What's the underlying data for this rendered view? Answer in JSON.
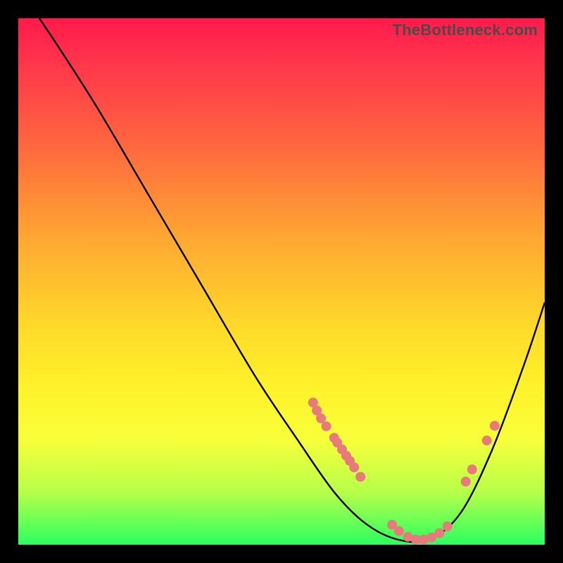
{
  "watermark": "TheBottleneck.com",
  "chart_data": {
    "type": "line",
    "title": "",
    "xlabel": "",
    "ylabel": "",
    "xlim": [
      0,
      100
    ],
    "ylim": [
      0,
      100
    ],
    "curve": [
      {
        "x": 4,
        "y": 100
      },
      {
        "x": 8,
        "y": 94
      },
      {
        "x": 15,
        "y": 83
      },
      {
        "x": 25,
        "y": 66
      },
      {
        "x": 35,
        "y": 49
      },
      {
        "x": 45,
        "y": 32
      },
      {
        "x": 53,
        "y": 20
      },
      {
        "x": 60,
        "y": 10
      },
      {
        "x": 66,
        "y": 4
      },
      {
        "x": 72,
        "y": 1
      },
      {
        "x": 78,
        "y": 1
      },
      {
        "x": 84,
        "y": 6
      },
      {
        "x": 90,
        "y": 18
      },
      {
        "x": 96,
        "y": 34
      },
      {
        "x": 100,
        "y": 46
      }
    ],
    "markers": [
      {
        "x": 56,
        "y": 27
      },
      {
        "x": 56.7,
        "y": 25.5
      },
      {
        "x": 57.5,
        "y": 24
      },
      {
        "x": 58.5,
        "y": 22.5
      },
      {
        "x": 60,
        "y": 20.3
      },
      {
        "x": 60.6,
        "y": 19.4
      },
      {
        "x": 61.5,
        "y": 18.1
      },
      {
        "x": 62.3,
        "y": 16.9
      },
      {
        "x": 63,
        "y": 15.9
      },
      {
        "x": 63.8,
        "y": 14.7
      },
      {
        "x": 65,
        "y": 12.9
      },
      {
        "x": 71,
        "y": 3.8
      },
      {
        "x": 72.3,
        "y": 2.6
      },
      {
        "x": 74,
        "y": 1.5
      },
      {
        "x": 75.5,
        "y": 1.0
      },
      {
        "x": 77,
        "y": 1.0
      },
      {
        "x": 78.5,
        "y": 1.4
      },
      {
        "x": 80,
        "y": 2.2
      },
      {
        "x": 81.5,
        "y": 3.5
      },
      {
        "x": 85,
        "y": 12.0
      },
      {
        "x": 86.2,
        "y": 14.3
      },
      {
        "x": 89,
        "y": 19.8
      },
      {
        "x": 90.5,
        "y": 22.6
      }
    ],
    "marker_color": "#e77a7a",
    "marker_radius": 7,
    "line_color": "#000000",
    "line_width": 2.4
  }
}
